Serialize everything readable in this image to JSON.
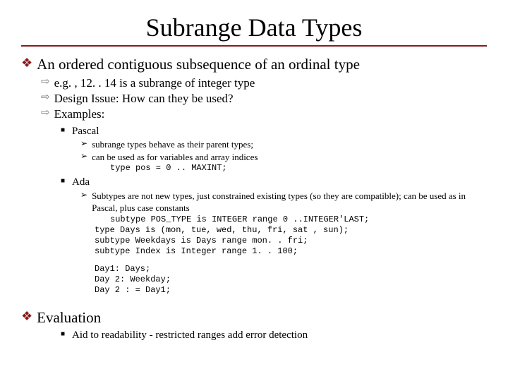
{
  "title": "Subrange Data Types",
  "s1": {
    "heading": "An ordered contiguous subsequence of an ordinal type",
    "b1": "e.g. , 12. . 14 is a subrange of integer type",
    "b2": "Design Issue: How can they be used?",
    "b3": "Examples:",
    "pascal": {
      "label": "Pascal",
      "p1": "subrange types behave as their parent types;",
      "p2": "can be used as for variables and array indices",
      "code": "type pos = 0 .. MAXINT;"
    },
    "ada": {
      "label": "Ada",
      "p1": "Subtypes are not new types, just constrained existing types (so they are compatible); can be used as in Pascal, plus case constants",
      "c1": "subtype POS_TYPE is INTEGER range 0 ..INTEGER'LAST;",
      "c2": "type Days is (mon, tue, wed, thu, fri, sat , sun);",
      "c3": "subtype Weekdays is Days range mon. . fri;",
      "c4": "subtype Index is Integer range 1. . 100;",
      "d1": "Day1: Days;",
      "d2": "Day 2: Weekday;",
      "d3": "Day 2 : = Day1;"
    }
  },
  "s2": {
    "heading": "Evaluation",
    "b1": "Aid to readability - restricted ranges add error detection"
  }
}
